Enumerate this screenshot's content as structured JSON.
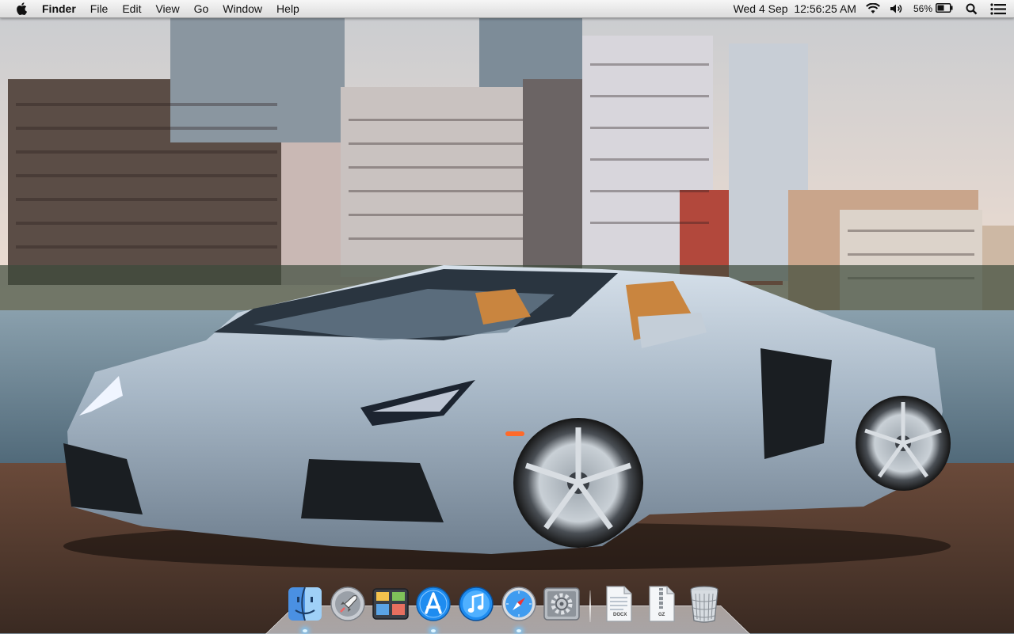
{
  "menubar": {
    "apple_icon": "apple-icon",
    "app_name": "Finder",
    "menus": [
      "File",
      "Edit",
      "View",
      "Go",
      "Window",
      "Help"
    ],
    "clock": "Wed 4 Sep  12:56:25 AM",
    "battery_percent": "56%",
    "status_icons": [
      "wifi-icon",
      "volume-icon",
      "battery-icon",
      "spotlight-icon",
      "notification-center-icon"
    ]
  },
  "dock": {
    "apps": [
      {
        "name": "Finder",
        "icon": "finder-icon",
        "running": true
      },
      {
        "name": "Launchpad",
        "icon": "launchpad-icon",
        "running": false
      },
      {
        "name": "Mission Control",
        "icon": "mission-control-icon",
        "running": false
      },
      {
        "name": "App Store",
        "icon": "app-store-icon",
        "running": true
      },
      {
        "name": "iTunes",
        "icon": "itunes-icon",
        "running": false
      },
      {
        "name": "Safari",
        "icon": "safari-icon",
        "running": true
      },
      {
        "name": "System Preferences",
        "icon": "system-preferences-icon",
        "running": false
      }
    ],
    "stacks": [
      {
        "label": "DOCX",
        "icon": "docx-document-icon"
      },
      {
        "label": "GZ",
        "icon": "gz-archive-icon"
      },
      {
        "label": "",
        "icon": "trash-icon"
      }
    ]
  },
  "colors": {
    "menubar_top": "#f6f6f6",
    "menubar_bottom": "#dcdcdc",
    "sky": "#e9d9cf",
    "water": "#6d8796",
    "car_body": "#a9b9c8"
  }
}
